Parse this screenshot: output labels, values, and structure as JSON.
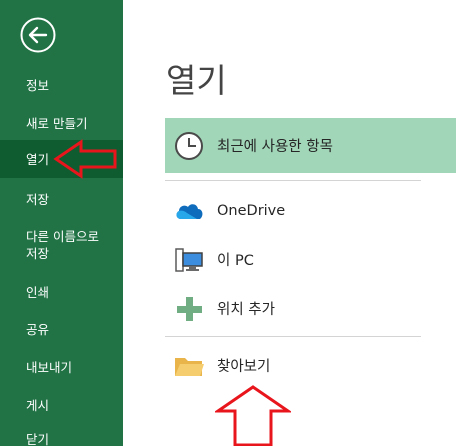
{
  "sidebar": {
    "items": [
      {
        "label": "정보"
      },
      {
        "label": "새로 만들기"
      },
      {
        "label": "열기"
      },
      {
        "label": "저장"
      },
      {
        "label": "다른 이름으로 저장"
      },
      {
        "label": "인쇄"
      },
      {
        "label": "공유"
      },
      {
        "label": "내보내기"
      },
      {
        "label": "게시"
      },
      {
        "label": "닫기"
      }
    ]
  },
  "main": {
    "title": "열기",
    "locations": [
      {
        "label": "최근에 사용한 항목",
        "icon": "clock-icon"
      },
      {
        "label": "OneDrive",
        "icon": "cloud-icon"
      },
      {
        "label": "이 PC",
        "icon": "computer-icon"
      },
      {
        "label": "위치 추가",
        "icon": "plus-icon"
      },
      {
        "label": "찾아보기",
        "icon": "folder-icon"
      }
    ]
  },
  "colors": {
    "sidebar_bg": "#217346",
    "sidebar_selected": "#0e5c2f",
    "selected_item_bg": "#a1d6b8",
    "annotation_red": "#e8161c"
  }
}
